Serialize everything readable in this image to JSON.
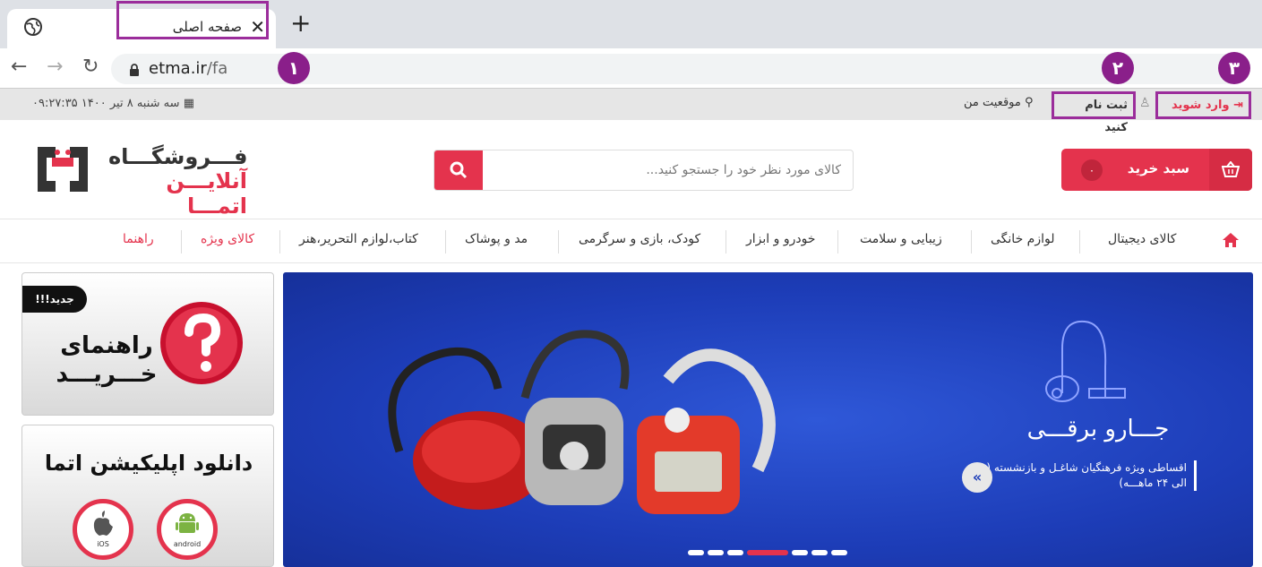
{
  "browser": {
    "tab_title": "صفحه اصلی",
    "url_domain": "etma.ir",
    "url_path": "/fa"
  },
  "callouts": [
    "١",
    "٢",
    "٣"
  ],
  "infobar": {
    "login": "وارد شوید",
    "register": "ثبت نام کنید",
    "location": "موقعیت من",
    "datetime": "سه شنبه ۸ تیر ۱۴۰۰   ۰۹:۲۷:۳۵"
  },
  "header": {
    "logo_line1": "فـــروشگـــاه",
    "logo_line2": "آنلایـــن اتمـــا",
    "search_placeholder": "کالای مورد نظر خود را جستجو کنید...",
    "cart_label": "سبد خرید",
    "cart_count": "۰"
  },
  "categories": [
    "کالای دیجیتال",
    "لوازم خانگی",
    "زیبایی و سلامت",
    "خودرو و ابزار",
    "کودک، بازی و سرگرمی",
    "مد و پوشاک",
    "کتاب،لوازم التحریر،هنر",
    "کالای ویژه",
    "راهنما"
  ],
  "banner": {
    "title": "جـــارو برقـــی",
    "subtitle": "اقساطی ویژه فرهنگیان شاغـل و بازنشسته (۶ الی ۲۴ ماهـــه)",
    "arrow": "«"
  },
  "side_banners": {
    "new_tag": "جدید!!!",
    "guide_line1": "راهنمای",
    "guide_line2": "خـــریـــد",
    "app_title": "دانلود اپلیکیشن اتما",
    "ios_label": "iOS",
    "android_label": "android"
  },
  "colors": {
    "accent": "#e4334d",
    "highlight": "#9b2d9b",
    "banner_blue": "#1d3db8"
  }
}
